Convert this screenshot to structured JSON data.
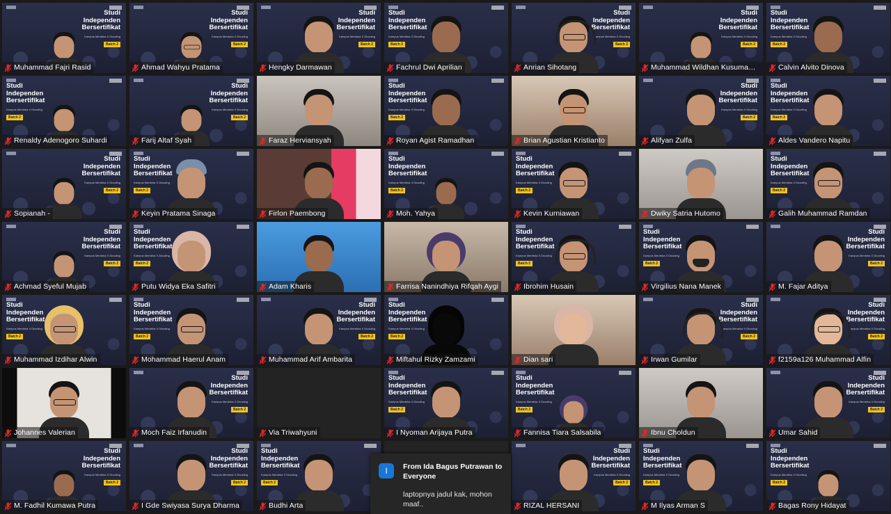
{
  "banner": {
    "title_line1": "Studi",
    "title_line2": "Independen",
    "title_line3": "Bersertifikat",
    "subtitle": "Kampus Merdeka X Dicoding",
    "batch": "Batch 2"
  },
  "participants": [
    {
      "name": "Muhammad Fajri Rasid",
      "mic_muted": true
    },
    {
      "name": "Ahmad Wahyu Pratama",
      "mic_muted": true
    },
    {
      "name": "Hengky Darmawan",
      "mic_muted": true
    },
    {
      "name": "Fachrul Dwi Aprilian",
      "mic_muted": true
    },
    {
      "name": "Anrian Sihotang",
      "mic_muted": true
    },
    {
      "name": "Muhammad Wildhan Kusumawa...",
      "mic_muted": true
    },
    {
      "name": "Calvin Alvito Dinova",
      "mic_muted": true
    },
    {
      "name": "Renaldy  Adenogoro Suhardi",
      "mic_muted": true
    },
    {
      "name": "Farij Altaf Syah",
      "mic_muted": true
    },
    {
      "name": "Faraz Herviansyah",
      "mic_muted": true
    },
    {
      "name": "Royan Agist Ramadhan",
      "mic_muted": true
    },
    {
      "name": "Brian Agustian Kristianto",
      "mic_muted": true
    },
    {
      "name": "Alifyan Zulfa",
      "mic_muted": true
    },
    {
      "name": "Aldes Vandero Napitu",
      "mic_muted": true
    },
    {
      "name": "Sopianah -",
      "mic_muted": true
    },
    {
      "name": "Keyin Pratama Sinaga",
      "mic_muted": true
    },
    {
      "name": "Firlon Paembong",
      "mic_muted": true
    },
    {
      "name": "Moh. Yahya",
      "mic_muted": true
    },
    {
      "name": "Kevin Kurniawan",
      "mic_muted": true
    },
    {
      "name": "Dwiky Satria Hutomo",
      "mic_muted": true
    },
    {
      "name": "Galih Muhammad Ramdan",
      "mic_muted": true
    },
    {
      "name": "Achmad Syeful Mujab",
      "mic_muted": true
    },
    {
      "name": "Putu Widya Eka Safitri",
      "mic_muted": true
    },
    {
      "name": "Adam Kharis",
      "mic_muted": true
    },
    {
      "name": "Farrisa Nanindhiya Rifqah Aygi",
      "mic_muted": true
    },
    {
      "name": "Ibrohim Husain",
      "mic_muted": true
    },
    {
      "name": "Virgilius Nana Manek",
      "mic_muted": true
    },
    {
      "name": "M. Fajar Aditya",
      "mic_muted": true
    },
    {
      "name": "Muhammad Izdihar Alwin",
      "mic_muted": true
    },
    {
      "name": "Mohammad Haerul Anam",
      "mic_muted": true
    },
    {
      "name": "Muhammad Arif Ambarita",
      "mic_muted": true
    },
    {
      "name": "Miftahul Rizky Zamzami",
      "mic_muted": true
    },
    {
      "name": "Dian sari",
      "mic_muted": true
    },
    {
      "name": "Irwan Gumilar",
      "mic_muted": true
    },
    {
      "name": "f2159a126 Muhammad Alfin",
      "mic_muted": true
    },
    {
      "name": "Johannes Valerian",
      "mic_muted": true
    },
    {
      "name": "Moch Faiz Irfanudin",
      "mic_muted": true
    },
    {
      "name": "Via Triwahyuni",
      "mic_muted": true
    },
    {
      "name": "I Nyoman Arijaya Putra",
      "mic_muted": true
    },
    {
      "name": "Fannisa Tiara Salsabila",
      "mic_muted": true
    },
    {
      "name": "Ibnu Choldun",
      "mic_muted": true
    },
    {
      "name": "Umar Sahid",
      "mic_muted": true
    },
    {
      "name": "M. Fadhil Kumawa Putra",
      "mic_muted": true
    },
    {
      "name": "I Gde Swiyasa Surya Dharma",
      "mic_muted": true
    },
    {
      "name": "Budhi Arta",
      "mic_muted": true
    },
    {
      "name": "",
      "mic_muted": false
    },
    {
      "name": "RIZAL HERSANI",
      "mic_muted": true
    },
    {
      "name": "M Ilyas Arman S",
      "mic_muted": true
    },
    {
      "name": "Bagas Rony Hidayat",
      "mic_muted": true
    }
  ],
  "chat_toast": {
    "avatar_letter": "I",
    "from": "From Ida Bagus Putrawan to Everyone",
    "message": "laptopnya jadul kak, mohon maaf.."
  },
  "colors": {
    "mic_muted": "#e02828",
    "batch_tag": "#f3c31c",
    "toast_avatar": "#1877d4"
  }
}
